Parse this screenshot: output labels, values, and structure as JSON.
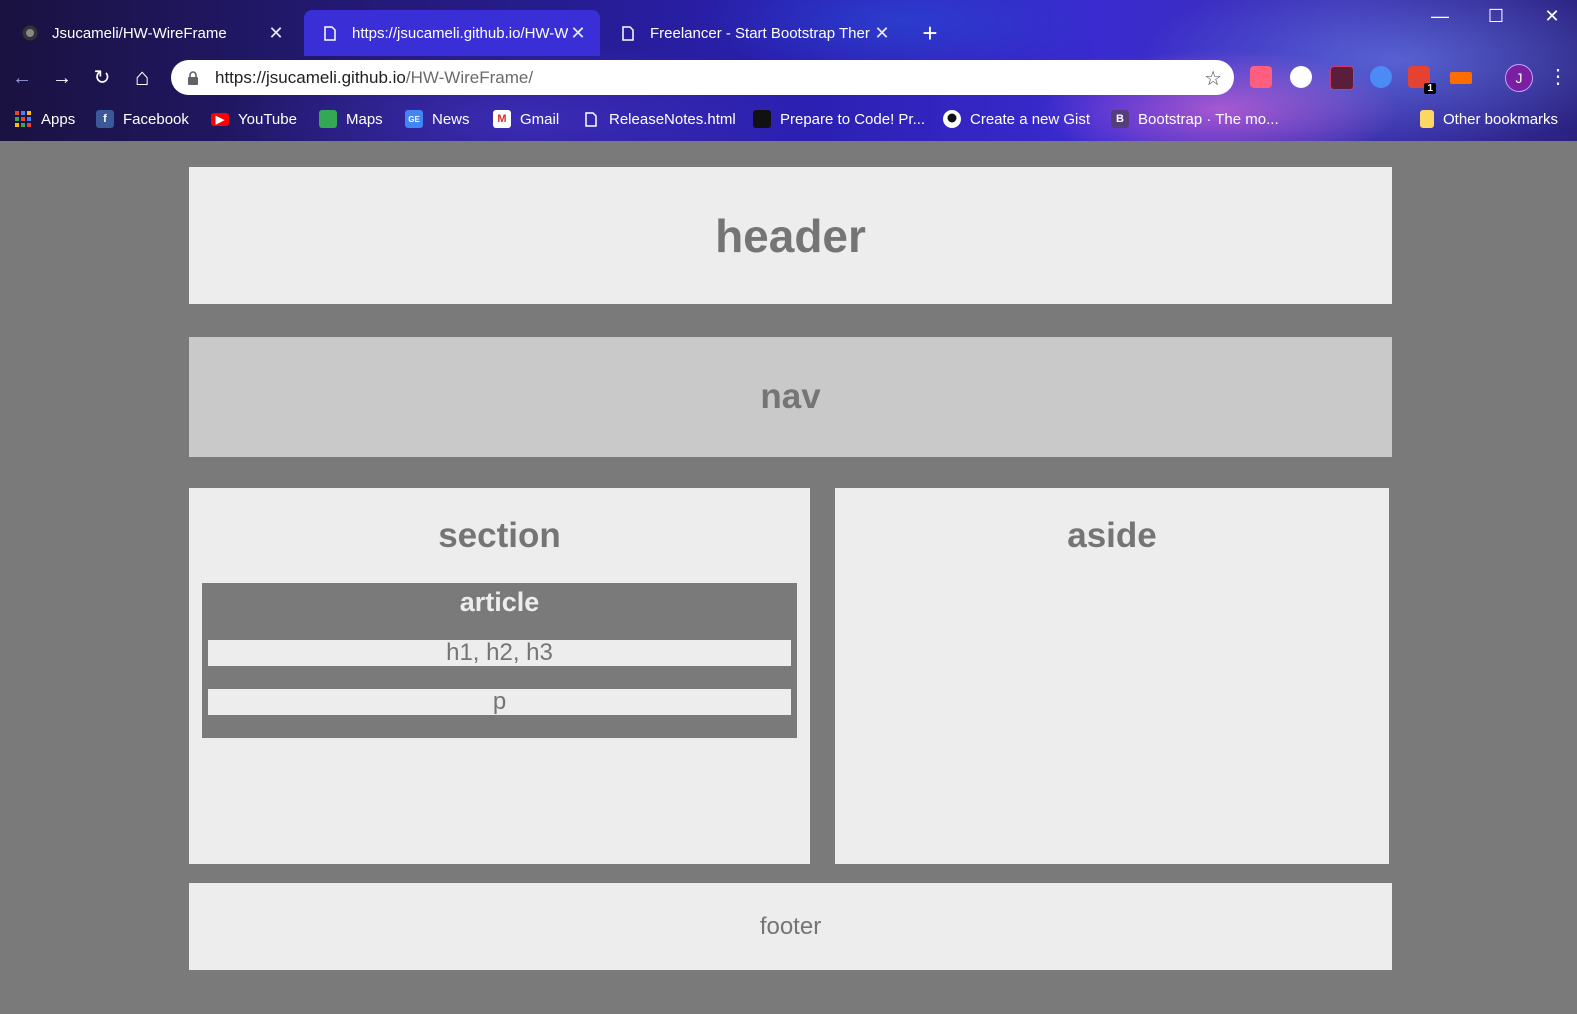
{
  "browser": {
    "tabs": [
      {
        "label": "Jsucameli/HW-WireFrame",
        "icon": "github-icon",
        "active": false
      },
      {
        "label": "https://jsucameli.github.io/HW-W",
        "icon": "page-icon",
        "active": true
      },
      {
        "label": "Freelancer - Start Bootstrap Ther",
        "icon": "page-icon",
        "active": false
      }
    ],
    "new_tab": "+",
    "window": {
      "minimize": "—",
      "maximize": "☐",
      "close": "✕"
    },
    "nav": {
      "back": "←",
      "forward": "→",
      "reload": "↻",
      "home": "⌂"
    },
    "url_host": "https://jsucameli.github.io",
    "url_path": "/HW-WireFrame/",
    "star": "☆",
    "profile_initial": "J",
    "extension_badge": "1",
    "menu": "⋮",
    "bookmarks": [
      {
        "label": "Apps",
        "icon": "apps-grid-icon"
      },
      {
        "label": "Facebook",
        "icon": "facebook-icon"
      },
      {
        "label": "YouTube",
        "icon": "youtube-icon"
      },
      {
        "label": "Maps",
        "icon": "maps-icon"
      },
      {
        "label": "News",
        "icon": "news-icon"
      },
      {
        "label": "Gmail",
        "icon": "gmail-icon"
      },
      {
        "label": "ReleaseNotes.html",
        "icon": "page-icon"
      },
      {
        "label": "Prepare to Code! Pr...",
        "icon": "book-icon"
      },
      {
        "label": "Create a new Gist",
        "icon": "github-icon"
      },
      {
        "label": "Bootstrap · The mo...",
        "icon": "bootstrap-icon"
      }
    ],
    "other_bookmarks": "Other bookmarks"
  },
  "page": {
    "header": "header",
    "nav": "nav",
    "section": "section",
    "article": "article",
    "headings": "h1, h2, h3",
    "paragraph": "p",
    "aside": "aside",
    "footer": "footer"
  },
  "colors": {
    "page_bg": "#7a7a7a",
    "block_bg": "#ededed",
    "nav_bg": "#c9c9c9",
    "text": "#757575"
  }
}
